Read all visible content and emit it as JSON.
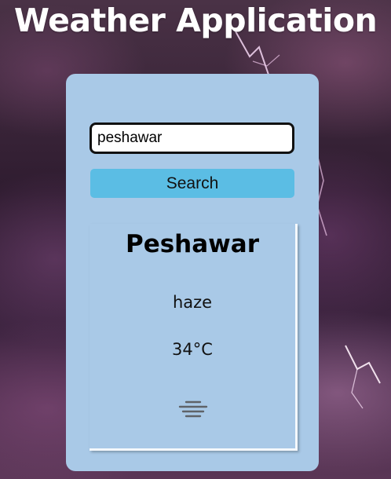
{
  "app": {
    "title": "Weather Application"
  },
  "search": {
    "value": "peshawar",
    "button_label": "Search"
  },
  "weather": {
    "city": "Peshawar",
    "description": "haze",
    "temperature": "34°C",
    "icon": "haze-icon"
  },
  "colors": {
    "card": "#a9c9e7",
    "button": "#5bbde4"
  }
}
